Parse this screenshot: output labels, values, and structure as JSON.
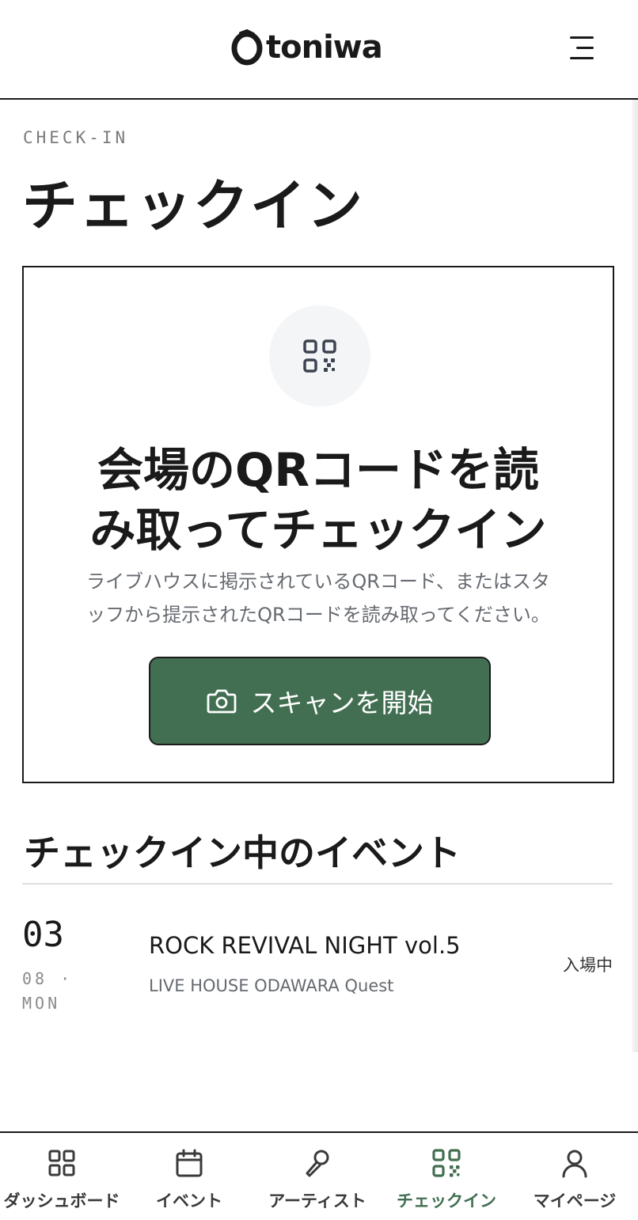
{
  "header": {
    "logo_text": "toniwa",
    "menu_icon": "hamburger-menu-icon"
  },
  "page": {
    "eyebrow": "CHECK-IN",
    "title": "チェックイン"
  },
  "scan_card": {
    "icon": "qr-code-icon",
    "headline_line1": "会場のQRコードを読",
    "headline_line2": "み取ってチェックイン",
    "description_line1": "ライブハウスに掲示されているQRコード、またはスタ",
    "description_line2": "ッフから提示されたQRコードを読み取ってください。",
    "button_label": "スキャンを開始",
    "button_icon": "camera-icon",
    "accent_color": "#426f52"
  },
  "checked_in_section": {
    "title": "チェックイン中のイベント",
    "events": [
      {
        "day": "03",
        "month_weekday_line1": "08 ·",
        "month_weekday_line2": "MON",
        "name": "ROCK REVIVAL NIGHT vol.5",
        "venue": "LIVE HOUSE ODAWARA Quest",
        "status": "入場中"
      }
    ]
  },
  "bottom_nav": {
    "items": [
      {
        "label": "ダッシュボード",
        "icon": "dashboard-grid-icon",
        "active": false
      },
      {
        "label": "イベント",
        "icon": "calendar-icon",
        "active": false
      },
      {
        "label": "アーティスト",
        "icon": "microphone-icon",
        "active": false
      },
      {
        "label": "チェックイン",
        "icon": "qr-code-icon",
        "active": true
      },
      {
        "label": "マイページ",
        "icon": "user-icon",
        "active": false
      }
    ]
  }
}
